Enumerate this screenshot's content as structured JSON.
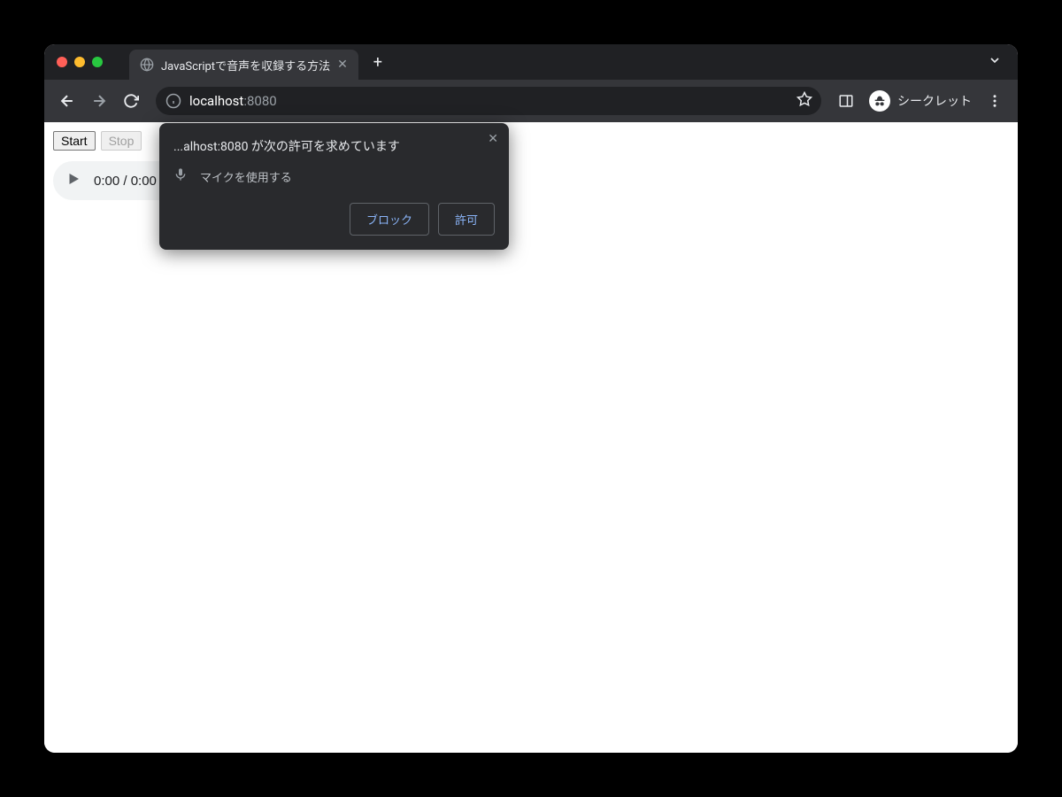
{
  "tab": {
    "title": "JavaScriptで音声を収録する方法"
  },
  "addressbar": {
    "host": "localhost",
    "port": ":8080"
  },
  "incognito": {
    "label": "シークレット"
  },
  "page": {
    "start_button": "Start",
    "stop_button": "Stop",
    "audio_time": "0:00 / 0:00"
  },
  "permission": {
    "title": "...alhost:8080 が次の許可を求めています",
    "mic_label": "マイクを使用する",
    "block": "ブロック",
    "allow": "許可"
  }
}
